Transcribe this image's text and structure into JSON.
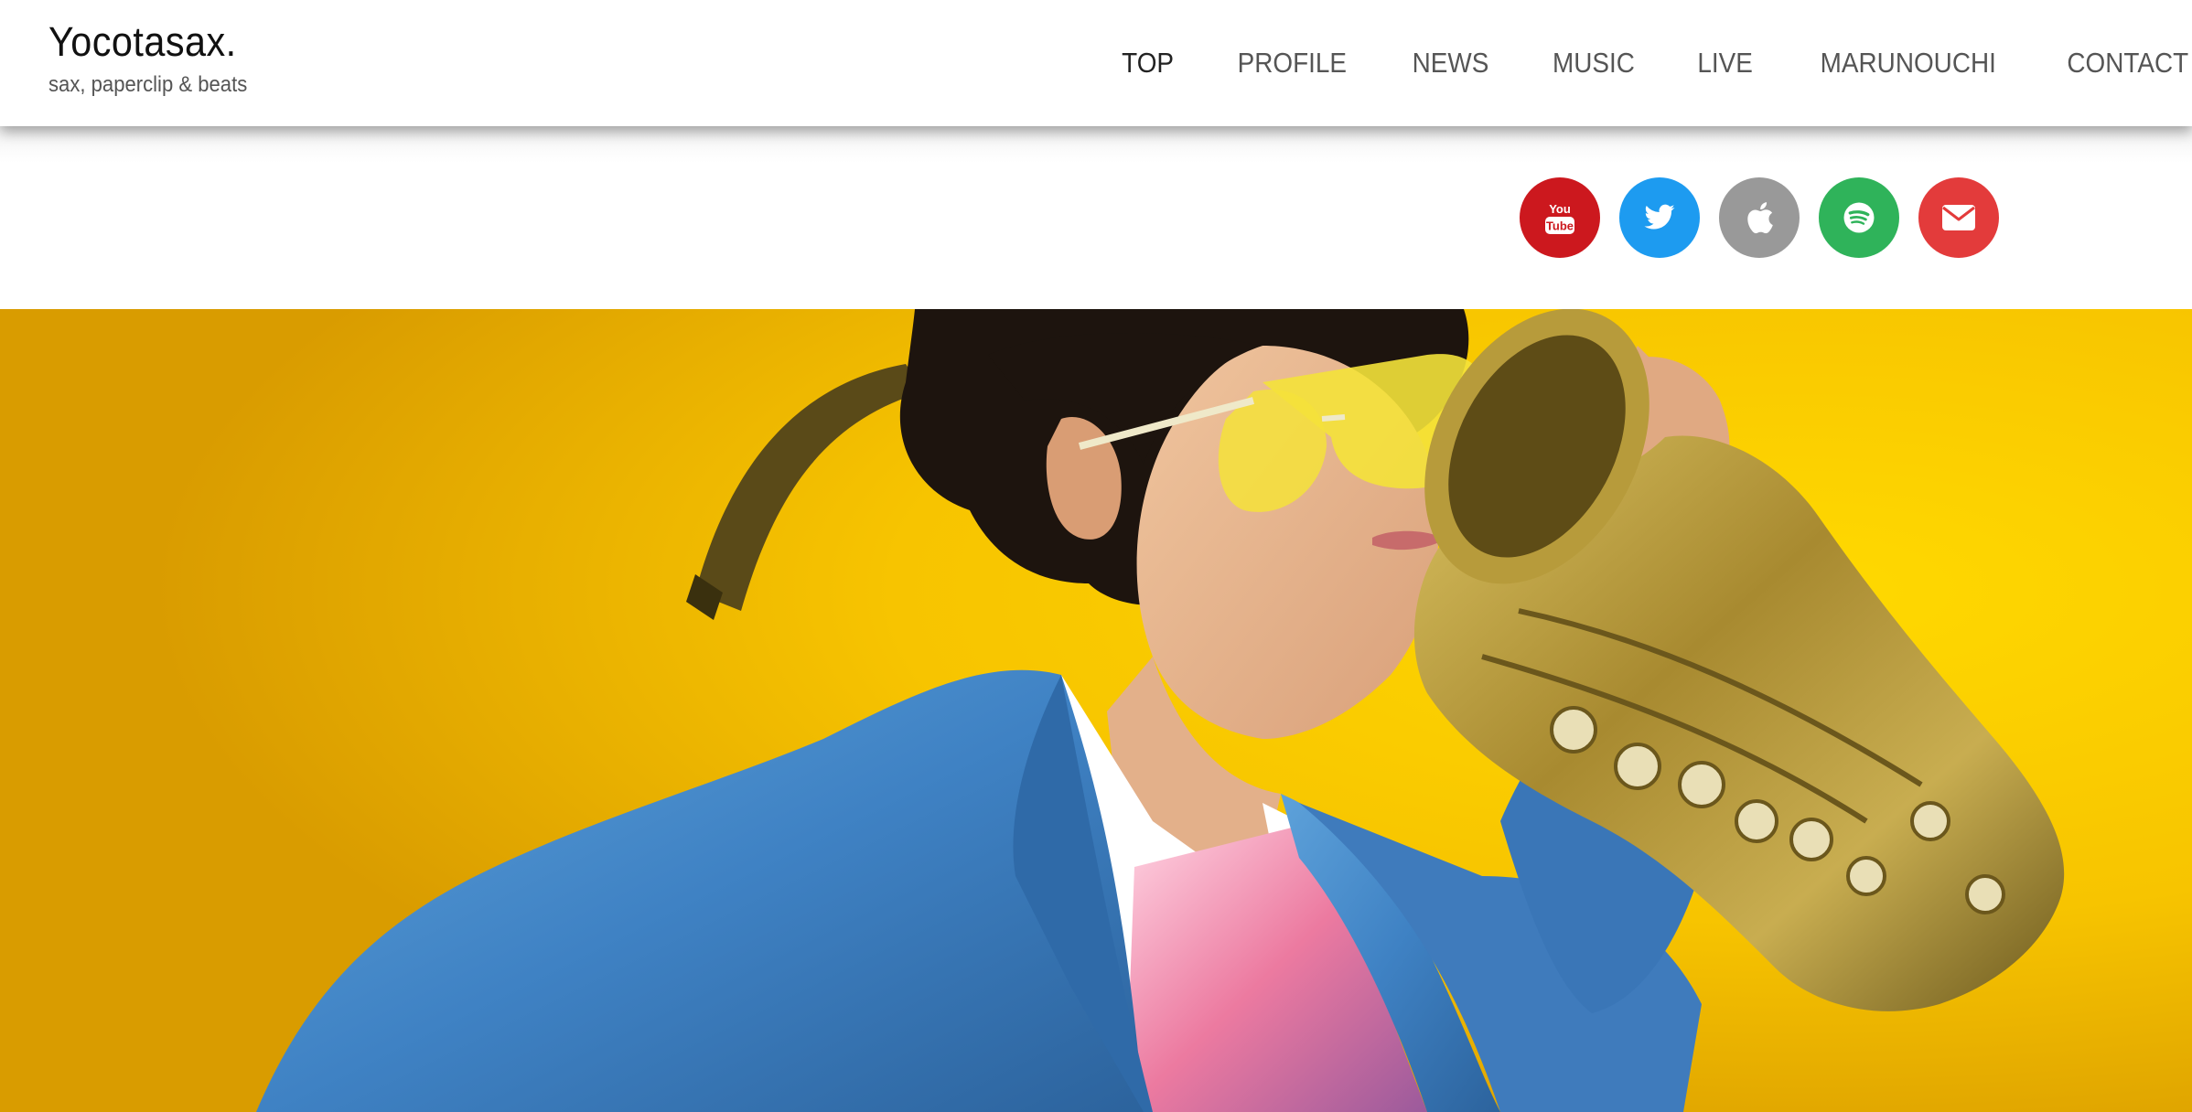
{
  "site": {
    "title": "Yocotasax.",
    "tagline": "sax, paperclip & beats"
  },
  "nav": {
    "items": [
      {
        "label": "TOP",
        "active": true
      },
      {
        "label": "PROFILE",
        "active": false
      },
      {
        "label": "NEWS",
        "active": false
      },
      {
        "label": "MUSIC",
        "active": false
      },
      {
        "label": "LIVE",
        "active": false
      },
      {
        "label": "MARUNOUCHI",
        "active": false
      },
      {
        "label": "CONTACT",
        "active": false
      }
    ]
  },
  "social": {
    "items": [
      {
        "icon": "youtube-icon",
        "color": "#cc181e",
        "glyph_top": "You",
        "glyph_bottom": "Tube"
      },
      {
        "icon": "twitter-icon",
        "color": "#1d9bf0"
      },
      {
        "icon": "apple-icon",
        "color": "#999999"
      },
      {
        "icon": "spotify-icon",
        "color": "#2fb35a"
      },
      {
        "icon": "mail-icon",
        "color": "#e33b3b"
      }
    ]
  },
  "hero": {
    "image": "saxophonist-portrait",
    "background_color": "#f9c800",
    "jacket_color": "#3f82c4",
    "shirt_color": "#ec7aa0",
    "glasses_color": "#f4e23a"
  }
}
